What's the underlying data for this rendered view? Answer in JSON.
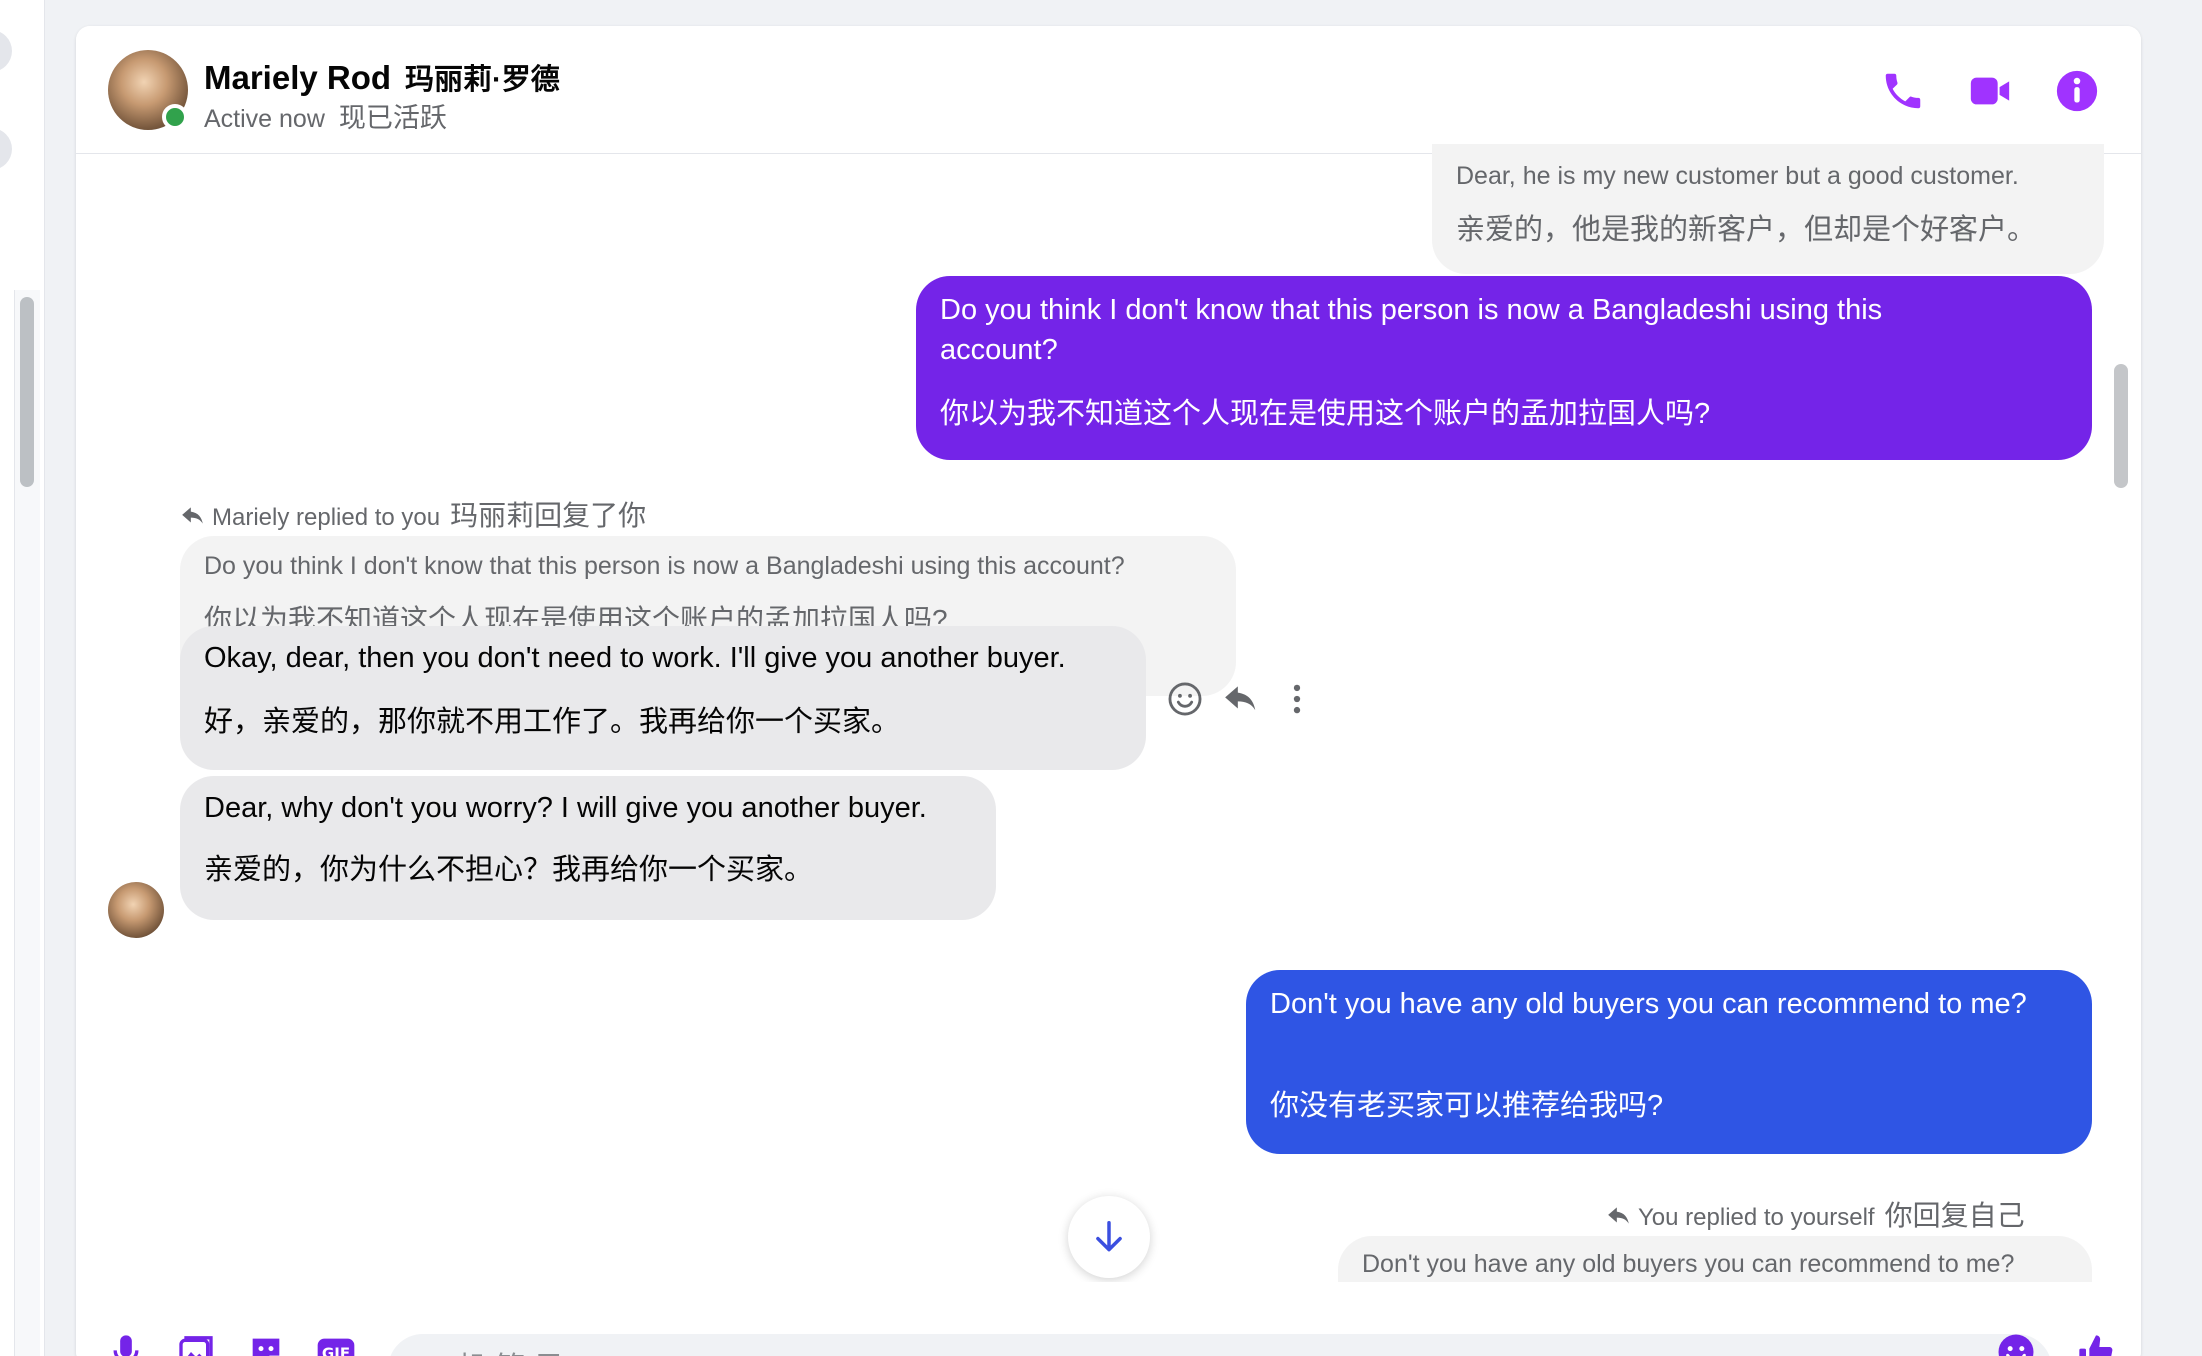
{
  "colors": {
    "accent": "#a033ff",
    "purple_bubble": "#7424e8",
    "blue_bubble": "#2f55e4",
    "active": "#31a24c"
  },
  "header": {
    "name": "Mariely Rod",
    "name_cn": "玛丽莉·罗德",
    "status": "Active now",
    "status_cn": "现已活跃",
    "icons": [
      "phone-icon",
      "video-icon",
      "info-icon"
    ]
  },
  "messages": {
    "m1": {
      "line1": "Dear, he is my new customer but a good customer.",
      "line2": "亲爱的，他是我的新客户，但却是个好客户。"
    },
    "m2": {
      "line1": "Do you think I don't know that this person is now a Bangladeshi using this",
      "line2": "account?",
      "line3": "你以为我不知道这个人现在是使用这个账户的孟加拉国人吗?"
    },
    "reply1": {
      "label": "Mariely replied to you",
      "label_cn": "玛丽莉回复了你"
    },
    "quote1": {
      "line1": "Do you think I don't know that this person is now a Bangladeshi using this account?",
      "line2": "你以为我不知道这个人现在是使用这个账户的孟加拉国人吗?"
    },
    "m3": {
      "line1": "Okay, dear, then you don't need to work. I'll give you another buyer.",
      "line2": "好，亲爱的，那你就不用工作了。我再给你一个买家。"
    },
    "m4": {
      "line1": "Dear, why don't you worry? I will give you another buyer.",
      "line2": "亲爱的，你为什么不担心？我再给你一个买家。"
    },
    "m5": {
      "line1": "Don't you have any old buyers you can recommend to me?",
      "line2": "你没有老买家可以推荐给我吗?"
    },
    "reply2": {
      "label": "You replied to yourself",
      "label_cn": "你回复自己"
    },
    "quote2": {
      "line1": "Don't you have any old buyers you can recommend to me?"
    },
    "actions": [
      "smiley-icon",
      "reply-icon",
      "more-icon"
    ]
  },
  "composer": {
    "placeholder": "Aa 机 管 局",
    "icons": [
      "mic-icon",
      "gallery-icon",
      "sticker-icon",
      "gif-icon",
      "emoji-icon",
      "like-icon"
    ],
    "gif_label": "GIF"
  }
}
